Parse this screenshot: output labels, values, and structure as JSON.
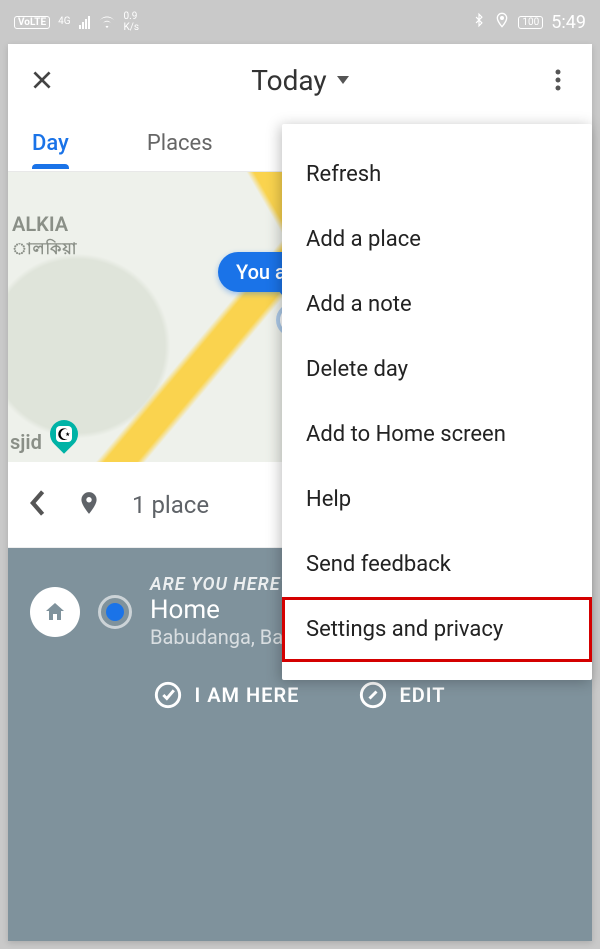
{
  "statusbar": {
    "volte": "VoLTE",
    "net_gen": "4G",
    "speed_value": "0.9",
    "speed_unit": "K/s",
    "battery": "100",
    "time": "5:49"
  },
  "header": {
    "title": "Today"
  },
  "tabs": {
    "list": [
      {
        "label": "Day",
        "active": true
      },
      {
        "label": "Places",
        "active": false
      }
    ]
  },
  "map": {
    "tooltip_text": "You are",
    "area_label_1": "ALKIA",
    "area_label_1_sub": "ালকিয়া",
    "area_label_2": "sjid"
  },
  "placebar": {
    "count_text": "1 place"
  },
  "prompt": {
    "question": "ARE YOU HERE?",
    "place_name": "Home",
    "address": "Babudanga, Ba",
    "action_here": "I AM HERE",
    "action_edit": "EDIT"
  },
  "menu": {
    "items": [
      {
        "label": "Refresh",
        "highlight": false
      },
      {
        "label": "Add a place",
        "highlight": false
      },
      {
        "label": "Add a note",
        "highlight": false
      },
      {
        "label": "Delete day",
        "highlight": false
      },
      {
        "label": "Add to Home screen",
        "highlight": false
      },
      {
        "label": "Help",
        "highlight": false
      },
      {
        "label": "Send feedback",
        "highlight": false
      },
      {
        "label": "Settings and privacy",
        "highlight": true
      }
    ]
  }
}
